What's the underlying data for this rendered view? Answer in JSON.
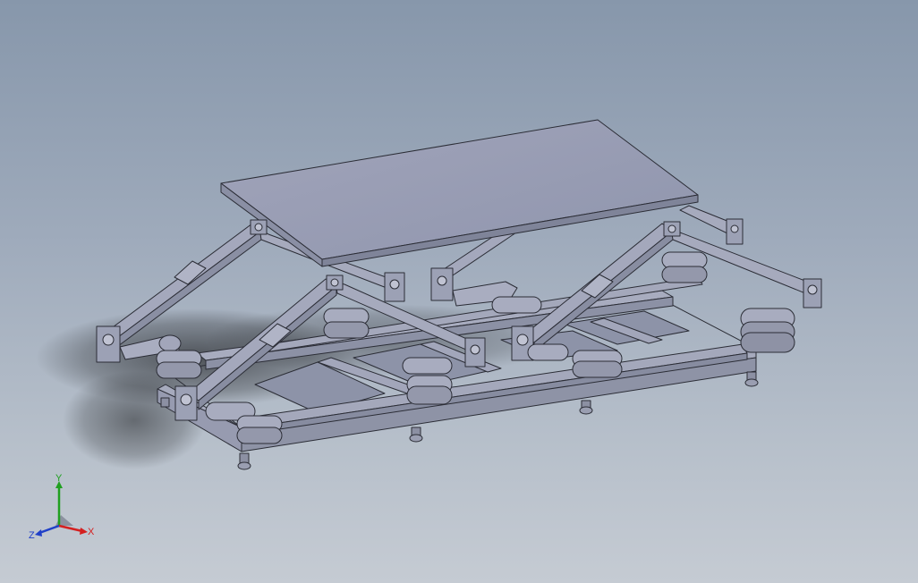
{
  "viewport": {
    "background_top": "#8797ab",
    "background_bottom": "#c5cbd3",
    "model_color": "#9ea3b8",
    "model_edge_color": "#2b2d36"
  },
  "model": {
    "description_icon": "scissor-lift-mechanism-model"
  },
  "triad": {
    "x_label": "X",
    "y_label": "Y",
    "z_label": "Z",
    "x_color": "#d42020",
    "y_color": "#20a020",
    "z_color": "#2040c8"
  }
}
